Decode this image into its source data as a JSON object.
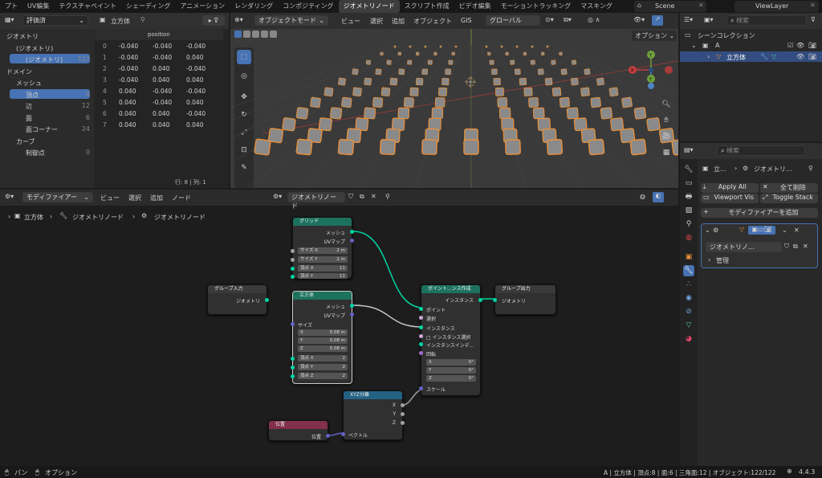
{
  "topbar": {
    "tabs": [
      "プト",
      "UV編集",
      "テクスチャペイント",
      "シェーディング",
      "アニメーション",
      "レンダリング",
      "コンポジティング",
      "ジオメトリノード",
      "スクリプト作成",
      "ビデオ編集",
      "モーショントラッキング",
      "マスキング"
    ],
    "active_index": 7,
    "scene": "Scene",
    "view_layer": "ViewLayer"
  },
  "spreadsheet": {
    "mode": "評価済",
    "object": "立方体",
    "tree": [
      {
        "label": "ジオメトリ",
        "level": 0
      },
      {
        "label": "(ジオメトリ)",
        "level": 1
      },
      {
        "label": "(ジオメトリ)",
        "level": 2,
        "count": "122",
        "selected": true
      },
      {
        "label": "ドメイン",
        "level": 0
      },
      {
        "label": "メッシュ",
        "level": 1
      },
      {
        "label": "頂点",
        "level": 2,
        "count": "8",
        "selected": true
      },
      {
        "label": "辺",
        "level": 2,
        "count": "12"
      },
      {
        "label": "面",
        "level": 2,
        "count": "6"
      },
      {
        "label": "面コーナー",
        "level": 2,
        "count": "24"
      },
      {
        "label": "カーブ",
        "level": 1
      },
      {
        "label": "制御点",
        "level": 2,
        "count": "0"
      }
    ],
    "column": "position",
    "rows": [
      [
        "0",
        "-0.040",
        "-0.040",
        "-0.040"
      ],
      [
        "1",
        "-0.040",
        "-0.040",
        "0.040"
      ],
      [
        "2",
        "-0.040",
        "0.040",
        "-0.040"
      ],
      [
        "3",
        "-0.040",
        "0.040",
        "0.040"
      ],
      [
        "4",
        "0.040",
        "-0.040",
        "-0.040"
      ],
      [
        "5",
        "0.040",
        "-0.040",
        "0.040"
      ],
      [
        "6",
        "0.040",
        "0.040",
        "-0.040"
      ],
      [
        "7",
        "0.040",
        "0.040",
        "0.040"
      ]
    ],
    "footer": "行: 8 | 列: 1"
  },
  "viewport": {
    "mode": "オブジェクトモード",
    "menus": [
      "ビュー",
      "選択",
      "追加",
      "オブジェクト",
      "GIS"
    ],
    "transform": "グローバル",
    "options": "オプション"
  },
  "outliner": {
    "search_placeholder": "検索",
    "collection": "シーンコレクション",
    "child": "A",
    "object": "立方体"
  },
  "properties": {
    "search_placeholder": "検索",
    "breadcrumb_obj": "立...",
    "breadcrumb_mod": "ジオメトリ...",
    "apply_all": "Apply All",
    "delete_all": "全て削除",
    "viewport_vis": "Viewport Vis",
    "toggle_stack": "Toggle Stack",
    "add_modifier": "モディファイアーを追加",
    "node_group": "ジオメトリノ...",
    "manage": "管理"
  },
  "node_editor": {
    "editor": "モディファイアー",
    "menus": [
      "ビュー",
      "選択",
      "追加",
      "ノード"
    ],
    "tree_name": "ジオメトリノード",
    "breadcrumb": [
      "立方体",
      "ジオメトリノード",
      "ジオメトリノード"
    ],
    "nodes": {
      "grid": {
        "title": "グリッド",
        "out1": "メッシュ",
        "out2": "UVマップ",
        "f1": [
          "サイズ X",
          "2 m"
        ],
        "f2": [
          "サイズ Y",
          "2 m"
        ],
        "f3": [
          "頂点 X",
          "11"
        ],
        "f4": [
          "頂点 Y",
          "11"
        ]
      },
      "group_in": {
        "title": "グループ入力",
        "out": "ジオメトリ"
      },
      "cube": {
        "title": "立方体",
        "out1": "メッシュ",
        "out2": "UVマップ",
        "size": "サイズ",
        "x": [
          "X",
          "0.08 m"
        ],
        "y": [
          "Y",
          "0.08 m"
        ],
        "z": [
          "Z",
          "0.08 m"
        ],
        "vx": [
          "頂点 X",
          "2"
        ],
        "vy": [
          "頂点 Y",
          "2"
        ],
        "vz": [
          "頂点 Z",
          "2"
        ]
      },
      "instance": {
        "title": "ポイント...ンス作成",
        "out": "インスタンス",
        "points": "ポイント",
        "select": "選択",
        "inst": "インスタンス",
        "inst_sel": "インスタンス選択",
        "inst_idx": "インスタンスインデ...",
        "rot": "回転",
        "rx": [
          "X",
          "0°"
        ],
        "ry": [
          "Y",
          "0°"
        ],
        "rz": [
          "Z",
          "0°"
        ],
        "scale": "スケール"
      },
      "group_out": {
        "title": "グループ出力",
        "in": "ジオメトリ"
      },
      "xyz": {
        "title": "XYZ分離",
        "x": "X",
        "y": "Y",
        "z": "Z",
        "vec": "ベクトル"
      },
      "position": {
        "title": "位置",
        "out": "位置"
      }
    }
  },
  "statusbar": {
    "left1": "パン",
    "left2": "オプション",
    "right": "A | 立方体 | 頂点:8 | 面:6 | 三角面:12 | オブジェクト:122/122",
    "version": "4.4.3"
  },
  "colors": {
    "accent": "#4772b3",
    "geometry_node": "#1d725e",
    "input_node": "#83314a",
    "vector_node": "#246283",
    "selection_orange": "#e8903a"
  }
}
